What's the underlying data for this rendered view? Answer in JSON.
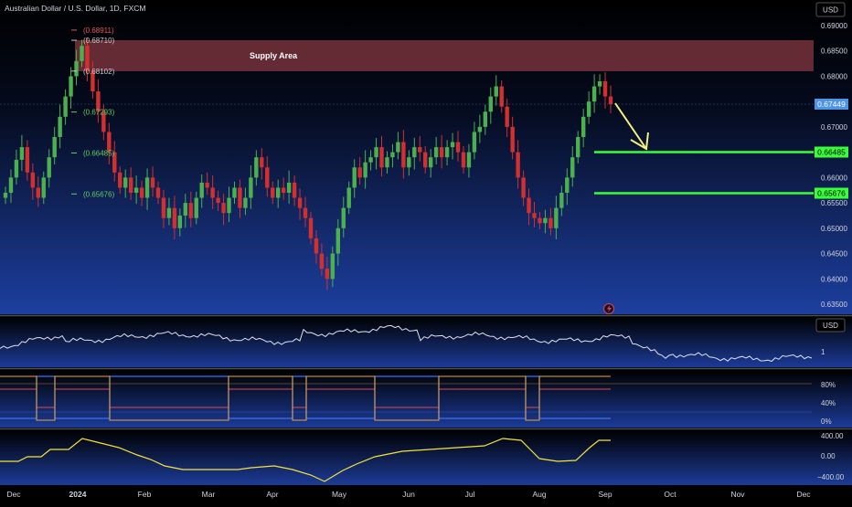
{
  "header": {
    "title": "Australian Dollar / U.S. Dollar, 1D, FXCM",
    "currency_button": "USD",
    "sub_currency_label": "USD"
  },
  "colors": {
    "bull": "#4caf50",
    "bear": "#d32f2f",
    "supply_fill": "#8b3a44",
    "support_line": "#39ff3a",
    "arrow": "#f5f07a",
    "price_tag": "#4d93e6",
    "panel_line": "#dfe3ea",
    "stoch_blue": "#3f6ff0",
    "stoch_red": "#e0484a",
    "stoch_orange": "#e9a43a",
    "osc_yellow": "#f5e33a"
  },
  "chart_data": [
    {
      "type": "candlestick",
      "title": "Australian Dollar / U.S. Dollar, 1D, FXCM",
      "x_labels": [
        "Dec",
        "2024",
        "Feb",
        "Mar",
        "Apr",
        "May",
        "Jun",
        "Jul",
        "Aug",
        "Sep",
        "Oct",
        "Nov",
        "Dec"
      ],
      "y_ticks": [
        "0.69000",
        "0.68500",
        "0.68000",
        "0.67500",
        "0.67000",
        "0.66500",
        "0.66000",
        "0.65500",
        "0.65000",
        "0.64500",
        "0.64000",
        "0.63500"
      ],
      "ylim": [
        0.6325,
        0.6925
      ],
      "current_price": "0.67449",
      "zones": [
        {
          "label": "Supply Area",
          "from": 0.681,
          "to": 0.6871
        }
      ],
      "support_levels": [
        "0.66485",
        "0.65676"
      ],
      "fib_labels": [
        {
          "text": "(0.68911)",
          "value": 0.68911,
          "color": "#e05a5a"
        },
        {
          "text": "(0.68710)",
          "value": 0.6871,
          "color": "#c8c8c8"
        },
        {
          "text": "(0.68102)",
          "value": 0.68102,
          "color": "#c8c8c8"
        },
        {
          "text": "(0.67293)",
          "value": 0.67293,
          "color": "#5fcf5f"
        },
        {
          "text": "(0.66485)",
          "value": 0.66485,
          "color": "#5fcf5f"
        },
        {
          "text": "(0.65676)",
          "value": 0.65676,
          "color": "#5fcf5f"
        }
      ],
      "closes": [
        0.657,
        0.66,
        0.6635,
        0.666,
        0.661,
        0.658,
        0.656,
        0.66,
        0.664,
        0.668,
        0.672,
        0.676,
        0.68,
        0.683,
        0.686,
        0.681,
        0.677,
        0.673,
        0.669,
        0.665,
        0.661,
        0.658,
        0.66,
        0.657,
        0.658,
        0.656,
        0.66,
        0.658,
        0.656,
        0.652,
        0.654,
        0.65,
        0.6525,
        0.655,
        0.652,
        0.656,
        0.659,
        0.658,
        0.656,
        0.655,
        0.653,
        0.656,
        0.658,
        0.654,
        0.656,
        0.66,
        0.664,
        0.662,
        0.658,
        0.656,
        0.658,
        0.657,
        0.659,
        0.656,
        0.654,
        0.652,
        0.648,
        0.645,
        0.642,
        0.64,
        0.645,
        0.65,
        0.654,
        0.658,
        0.662,
        0.66,
        0.663,
        0.664,
        0.666,
        0.662,
        0.664,
        0.665,
        0.667,
        0.662,
        0.664,
        0.666,
        0.665,
        0.662,
        0.664,
        0.666,
        0.664,
        0.666,
        0.667,
        0.665,
        0.662,
        0.665,
        0.669,
        0.67,
        0.673,
        0.676,
        0.678,
        0.674,
        0.67,
        0.665,
        0.66,
        0.656,
        0.653,
        0.652,
        0.651,
        0.652,
        0.65,
        0.654,
        0.657,
        0.66,
        0.664,
        0.668,
        0.672,
        0.675,
        0.678,
        0.679,
        0.676,
        0.6745
      ],
      "indicators": [
        {
          "type": "line",
          "label": "USD",
          "tick": "1"
        },
        {
          "type": "stochastic-lines",
          "ticks": [
            "80%",
            "40%",
            "0%"
          ]
        },
        {
          "type": "line",
          "ticks": [
            "400.00",
            "0.00",
            "−400.00"
          ]
        }
      ]
    }
  ]
}
